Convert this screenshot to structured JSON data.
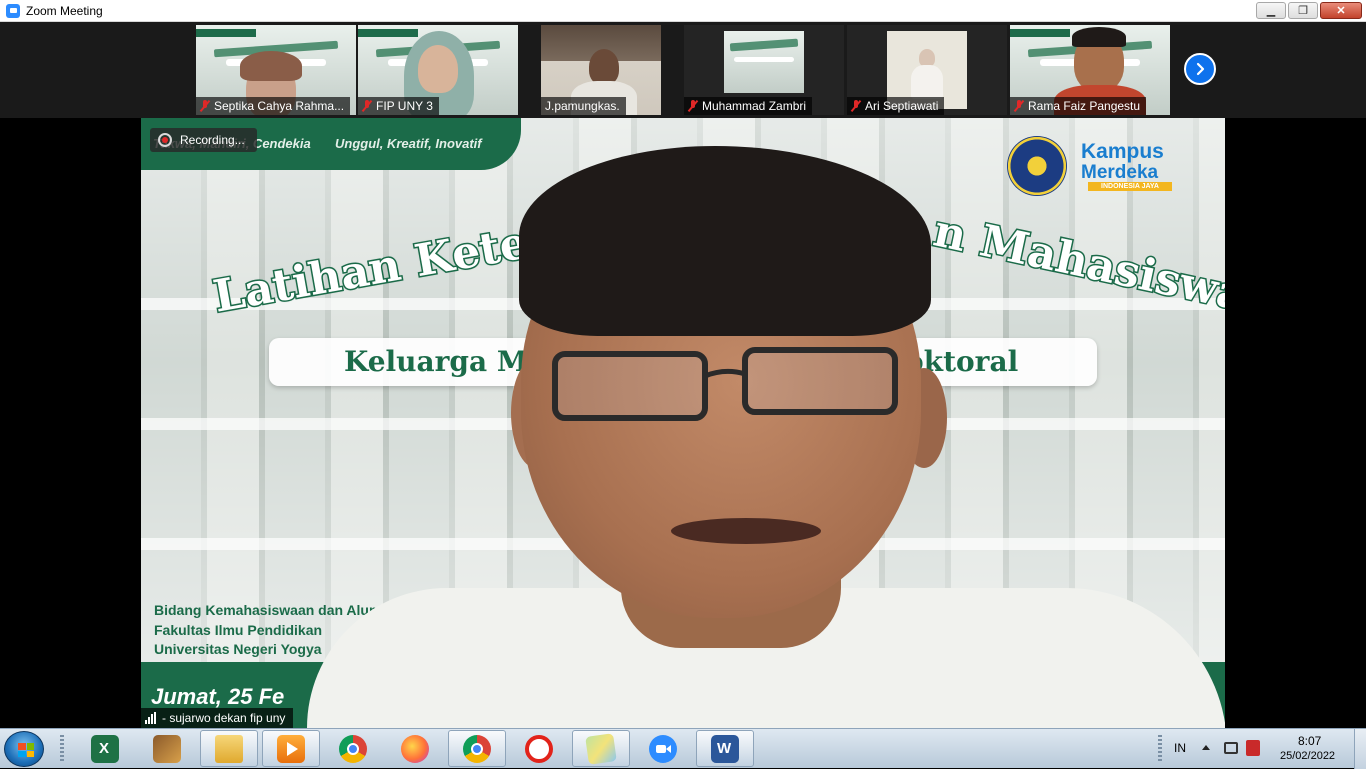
{
  "window": {
    "title": "Zoom Meeting",
    "controls": {
      "minimize": "▁",
      "restore": "❐",
      "close": "✕"
    }
  },
  "gallery": {
    "participants": [
      {
        "name": "Septika Cahya Rahma...",
        "muted": true
      },
      {
        "name": "FIP UNY 3",
        "muted": true
      },
      {
        "name": "J.pamungkas.",
        "muted": false
      },
      {
        "name": "Muhammad Zambri",
        "muted": true
      },
      {
        "name": "Ari Septiawati",
        "muted": true
      },
      {
        "name": "Rama Faiz Pangestu",
        "muted": true
      }
    ],
    "next_icon": "chevron-right-icon"
  },
  "main_video": {
    "recording_label": "Recording...",
    "speaker_name": "- sujarwo dekan fip uny",
    "slide": {
      "tagline_left": "Takwa, Mandiri, Cendekia",
      "tagline_right": "Unggul, Kreatif, Inovatif",
      "logo_line1": "Kampus",
      "logo_line2": "Merdeka",
      "logo_line3": "INDONESIA JAYA",
      "title_left": "Latihan Keteram",
      "title_right": "n Mahasiswa",
      "subtitle_left": "Keluarga Ma",
      "subtitle_right": "oktoral",
      "org_line1": "Bidang Kemahasiswaan dan Alum",
      "org_line2": "Fakultas Ilmu Pendidikan",
      "org_line3": "Universitas Negeri Yogya",
      "date": "Jumat, 25 Fe"
    }
  },
  "taskbar": {
    "apps": [
      {
        "name": "excel"
      },
      {
        "name": "installer"
      },
      {
        "name": "file-explorer"
      },
      {
        "name": "media-player"
      },
      {
        "name": "chrome"
      },
      {
        "name": "firefox"
      },
      {
        "name": "chrome-profile"
      },
      {
        "name": "anydesk"
      },
      {
        "name": "photos"
      },
      {
        "name": "zoom"
      },
      {
        "name": "word"
      }
    ],
    "language": "IN",
    "time": "8:07",
    "date": "25/02/2022"
  },
  "colors": {
    "accent_green": "#1b6b49",
    "zoom_blue": "#0e72ed",
    "muted_red": "#e02828"
  }
}
